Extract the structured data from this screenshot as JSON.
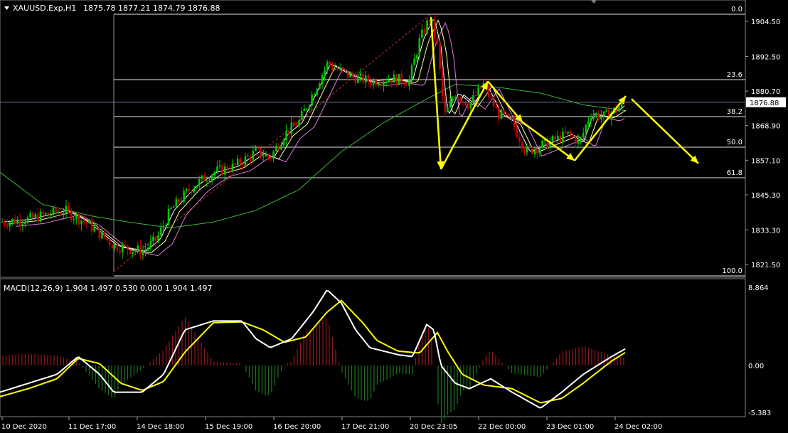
{
  "header": {
    "menu_arrow": "triangle-down",
    "symbol": "XAUUSD.Exp,H1",
    "ohlc": "1875.78 1877.21 1874.79 1876.88"
  },
  "price_scale": {
    "labels": [
      "1904.50",
      "1892.50",
      "1880.70",
      "1868.90",
      "1857.10",
      "1845.30",
      "1833.30",
      "1821.50"
    ],
    "values": [
      1904.5,
      1892.5,
      1880.7,
      1868.9,
      1857.1,
      1845.3,
      1833.3,
      1821.5
    ],
    "current_price": "1876.88"
  },
  "fibonacci": {
    "levels": [
      "0.0",
      "23.6",
      "38.2",
      "50.0",
      "61.8",
      "100.0"
    ],
    "ratios": [
      0,
      0.236,
      0.382,
      0.5,
      0.618,
      1.0
    ],
    "high": 1908.0,
    "low": 1818.6
  },
  "macd": {
    "label": "MACD(12,26,9) 1.904 1.497 0.530 0.000 1.904 1.497",
    "scale_labels": [
      "8.864",
      "0.00",
      "-5.383"
    ],
    "scale_values": [
      8.864,
      0,
      -5.383
    ]
  },
  "time_axis": {
    "labels": [
      "10 Dec 2020",
      "11 Dec 17:00",
      "14 Dec 18:00",
      "15 Dec 19:00",
      "16 Dec 20:00",
      "17 Dec 21:00",
      "20 Dec 23:05",
      "22 Dec 00:00",
      "23 Dec 01:00",
      "24 Dec 02:00"
    ]
  },
  "chart_data": {
    "type": "candlestick",
    "symbol": "XAUUSD",
    "timeframe": "H1",
    "ylim": [
      1815,
      1912
    ],
    "ma_slow_keypoints": [
      [
        0,
        1853
      ],
      [
        60,
        1842
      ],
      [
        130,
        1838
      ],
      [
        180,
        1836
      ],
      [
        240,
        1834
      ],
      [
        300,
        1836
      ],
      [
        360,
        1840
      ],
      [
        420,
        1847
      ],
      [
        480,
        1860
      ],
      [
        540,
        1870
      ],
      [
        600,
        1878
      ],
      [
        640,
        1883
      ],
      [
        700,
        1882
      ],
      [
        760,
        1880
      ],
      [
        820,
        1876
      ],
      [
        880,
        1874
      ]
    ],
    "price_path": [
      [
        0,
        1836
      ],
      [
        40,
        1837
      ],
      [
        90,
        1840
      ],
      [
        120,
        1836
      ],
      [
        160,
        1828
      ],
      [
        200,
        1826
      ],
      [
        220,
        1830
      ],
      [
        240,
        1840
      ],
      [
        270,
        1848
      ],
      [
        300,
        1853
      ],
      [
        330,
        1855
      ],
      [
        360,
        1860
      ],
      [
        380,
        1858
      ],
      [
        400,
        1866
      ],
      [
        420,
        1870
      ],
      [
        440,
        1880
      ],
      [
        460,
        1890
      ],
      [
        490,
        1886
      ],
      [
        520,
        1884
      ],
      [
        550,
        1885
      ],
      [
        575,
        1884
      ],
      [
        590,
        1898
      ],
      [
        605,
        1906
      ],
      [
        615,
        1896
      ],
      [
        625,
        1872
      ],
      [
        640,
        1880
      ],
      [
        660,
        1876
      ],
      [
        680,
        1883
      ],
      [
        700,
        1873
      ],
      [
        720,
        1870
      ],
      [
        740,
        1860
      ],
      [
        760,
        1862
      ],
      [
        780,
        1864
      ],
      [
        800,
        1866
      ],
      [
        815,
        1863
      ],
      [
        830,
        1873
      ],
      [
        850,
        1872
      ],
      [
        870,
        1875
      ],
      [
        880,
        1877
      ]
    ],
    "arrows": [
      {
        "points": [
          [
            606,
            1906
          ],
          [
            620,
            1854
          ]
        ]
      },
      {
        "points": [
          [
            620,
            1854
          ],
          [
            686,
            1884
          ]
        ]
      },
      {
        "points": [
          [
            686,
            1884
          ],
          [
            735,
            1870
          ]
        ]
      },
      {
        "points": [
          [
            735,
            1870
          ],
          [
            808,
            1857
          ]
        ]
      },
      {
        "points": [
          [
            808,
            1857
          ],
          [
            880,
            1879
          ]
        ]
      },
      {
        "points": [
          [
            888,
            1878
          ],
          [
            982,
            1856
          ]
        ]
      }
    ],
    "macd_main_keypoints": [
      [
        0,
        -3
      ],
      [
        40,
        -2
      ],
      [
        80,
        -1
      ],
      [
        110,
        1
      ],
      [
        140,
        -1
      ],
      [
        160,
        -3
      ],
      [
        200,
        -3
      ],
      [
        230,
        -1
      ],
      [
        260,
        4
      ],
      [
        300,
        5
      ],
      [
        340,
        5
      ],
      [
        360,
        3
      ],
      [
        380,
        2
      ],
      [
        410,
        3
      ],
      [
        440,
        6
      ],
      [
        460,
        8.5
      ],
      [
        480,
        7
      ],
      [
        500,
        4
      ],
      [
        520,
        2
      ],
      [
        540,
        1.6
      ],
      [
        560,
        1.2
      ],
      [
        580,
        1
      ],
      [
        600,
        4.6
      ],
      [
        610,
        4
      ],
      [
        620,
        0
      ],
      [
        640,
        -2
      ],
      [
        660,
        -2.6
      ],
      [
        690,
        -1.5
      ],
      [
        720,
        -3
      ],
      [
        760,
        -4.8
      ],
      [
        790,
        -3
      ],
      [
        820,
        -1
      ],
      [
        860,
        1
      ],
      [
        880,
        1.9
      ]
    ],
    "macd_signal_keypoints": [
      [
        0,
        -3.5
      ],
      [
        40,
        -2.6
      ],
      [
        80,
        -1.5
      ],
      [
        110,
        0.8
      ],
      [
        140,
        0.2
      ],
      [
        170,
        -2
      ],
      [
        200,
        -2.8
      ],
      [
        230,
        -1.8
      ],
      [
        260,
        1.5
      ],
      [
        300,
        4.8
      ],
      [
        340,
        4.9
      ],
      [
        370,
        4
      ],
      [
        400,
        2.6
      ],
      [
        430,
        3.2
      ],
      [
        460,
        6
      ],
      [
        480,
        7.3
      ],
      [
        510,
        4.8
      ],
      [
        530,
        2.8
      ],
      [
        560,
        1.6
      ],
      [
        590,
        1.4
      ],
      [
        615,
        3.7
      ],
      [
        630,
        1.5
      ],
      [
        650,
        -1
      ],
      [
        680,
        -2.2
      ],
      [
        720,
        -2.6
      ],
      [
        760,
        -4.2
      ],
      [
        790,
        -3.7
      ],
      [
        820,
        -2
      ],
      [
        860,
        0.5
      ],
      [
        880,
        1.5
      ]
    ]
  },
  "colors": {
    "background": "#000000",
    "bull": "#00c800",
    "bear": "#c80000",
    "ma_fast": "#ffffff",
    "ma_mid": "#ffff9f",
    "ma_pink": "#e07ad6",
    "ma_slow": "#3fb23f",
    "fib": "#e6e6e6",
    "arrow": "#ffff00",
    "macd_main": "#ffffff",
    "macd_signal": "#ffff00",
    "hist_pos": "#8b1a1a",
    "hist_neg": "#1e6b1e",
    "grid": "#808080"
  }
}
